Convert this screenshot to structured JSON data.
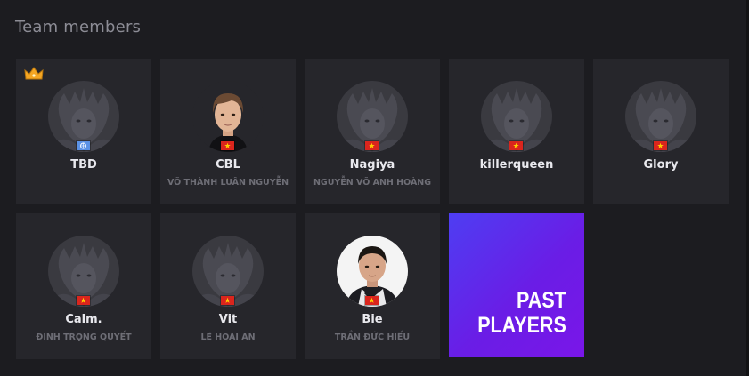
{
  "section": {
    "title": "Team members"
  },
  "members": [
    {
      "name": "TBD",
      "real_name": "",
      "flag": "un-flag-icon",
      "avatar": "placeholder",
      "captain": true
    },
    {
      "name": "CBL",
      "real_name": "VÕ THÀNH LUÂN NGUYỄN",
      "flag": "vietnam-flag-icon",
      "avatar": "photo"
    },
    {
      "name": "Nagiya",
      "real_name": "NGUYỄN VÕ ANH HOÀNG",
      "flag": "vietnam-flag-icon",
      "avatar": "placeholder"
    },
    {
      "name": "killerqueen",
      "real_name": "",
      "flag": "vietnam-flag-icon",
      "avatar": "placeholder"
    },
    {
      "name": "Glory",
      "real_name": "",
      "flag": "vietnam-flag-icon",
      "avatar": "placeholder"
    },
    {
      "name": "Calm.",
      "real_name": "ĐINH TRỌNG QUYẾT",
      "flag": "vietnam-flag-icon",
      "avatar": "placeholder"
    },
    {
      "name": "Vit",
      "real_name": "LÊ HOÀI AN",
      "flag": "vietnam-flag-icon",
      "avatar": "placeholder"
    },
    {
      "name": "Bie",
      "real_name": "TRẦN ĐỨC HIẾU",
      "flag": "vietnam-flag-icon",
      "avatar": "photo"
    }
  ],
  "past_players": {
    "line1": "PAST",
    "line2": "PLAYERS"
  },
  "colors": {
    "panel_bg": "#1c1c20",
    "card_bg": "#26262b",
    "name_text": "#e9e9ee",
    "real_name_text": "#6e6e76",
    "title_text": "#8c8c95",
    "past_players_gradient": [
      "#4e3ef2",
      "#7a16e8"
    ],
    "captain_crown": "#f5a623"
  }
}
